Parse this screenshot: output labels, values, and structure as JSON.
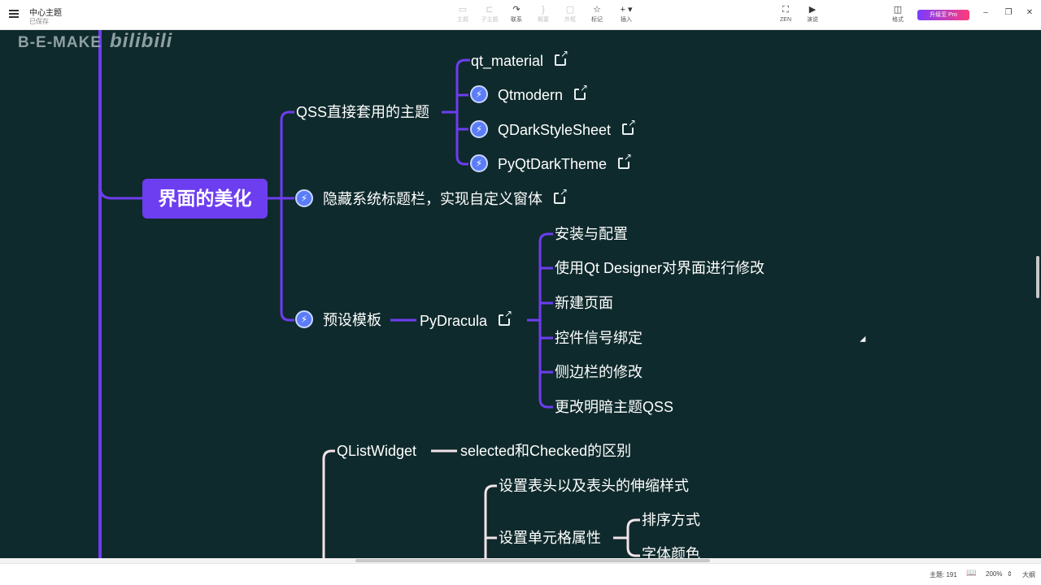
{
  "toolbar": {
    "doc_title": "中心主题",
    "doc_status": "已保存",
    "buttons": [
      {
        "label": "主题",
        "icon": "topic-icon",
        "glyph": "▭",
        "disabled": true
      },
      {
        "label": "子主题",
        "icon": "subtopic-icon",
        "glyph": "⊏",
        "disabled": true
      },
      {
        "label": "联系",
        "icon": "relationship-icon",
        "glyph": "↷",
        "disabled": false
      },
      {
        "label": "概要",
        "icon": "summary-icon",
        "glyph": "}",
        "disabled": true
      },
      {
        "label": "外框",
        "icon": "boundary-icon",
        "glyph": "▢",
        "disabled": true
      },
      {
        "label": "标记",
        "icon": "marker-icon",
        "glyph": "☆",
        "disabled": false
      },
      {
        "label": "插入",
        "icon": "insert-icon",
        "glyph": "+ ▾",
        "disabled": false
      },
      {
        "label": "ZEN",
        "icon": "zen-mode-icon",
        "glyph": "⛶",
        "disabled": false
      },
      {
        "label": "演说",
        "icon": "pitch-icon",
        "glyph": "▶",
        "disabled": false
      },
      {
        "label": "格式",
        "icon": "format-panel-icon",
        "glyph": "◫",
        "disabled": false
      }
    ],
    "upgrade_label": "升级至 Pro",
    "win_min": "–",
    "win_restore": "❐",
    "win_close": "✕"
  },
  "watermark": {
    "text": "B-E-MAKE",
    "logo": "bilibili"
  },
  "mindmap": {
    "main_topic": "界面的美化",
    "qss_theme": "QSS直接套用的主题",
    "qss_items": [
      "qt_material",
      "Qtmodern",
      "QDarkStyleSheet",
      "PyQtDarkTheme"
    ],
    "hide_titlebar": "隐藏系统标题栏，实现自定义窗体",
    "preset_template": "预设模板",
    "pydracula": "PyDracula",
    "pydracula_items": [
      "安装与配置",
      "使用Qt Designer对界面进行修改",
      "新建页面",
      "控件信号绑定",
      "侧边栏的修改",
      "更改明暗主题QSS"
    ],
    "qlistwidget": "QListWidget",
    "qlistwidget_child": "selected和Checked的区别",
    "header_style": "设置表头以及表头的伸缩样式",
    "cell_props": "设置单元格属性",
    "cell_props_items": [
      "排序方式",
      "字体颜色"
    ]
  },
  "colors": {
    "canvas_bg": "#0f2a2c",
    "branch_purple": "#6d3df0",
    "branch_pink": "#f3e3ea",
    "bolt_blue": "#5b7cf7"
  },
  "statusbar": {
    "topics": "主题: 191",
    "zoom": "200%",
    "outline": "大纲"
  }
}
